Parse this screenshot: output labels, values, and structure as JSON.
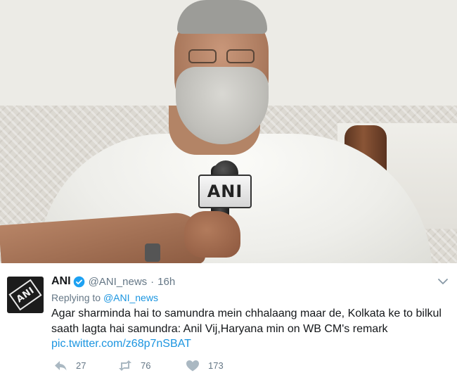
{
  "photo": {
    "mic_flag_text": "ANI"
  },
  "tweet": {
    "avatar_text": "ANI",
    "name": "ANI",
    "handle": "@ANI_news",
    "separator": "·",
    "time": "16h",
    "reply_prefix": "Replying to",
    "reply_to": "@ANI_news",
    "text": "Agar sharminda hai to samundra mein chhalaang maar de, Kolkata ke to bilkul saath lagta hai samundra: Anil Vij,Haryana min on WB CM's remark",
    "link": "pic.twitter.com/z68p7nSBAT",
    "stats": {
      "replies": "27",
      "retweets": "76",
      "likes": "173"
    }
  },
  "icons": [
    "verified-badge-icon",
    "chevron-down-icon",
    "reply-icon",
    "retweet-icon",
    "heart-icon"
  ],
  "colors": {
    "link": "#1b95e0",
    "verified": "#1da1f2",
    "secondary_text": "#657786",
    "primary_text": "#14171a"
  }
}
